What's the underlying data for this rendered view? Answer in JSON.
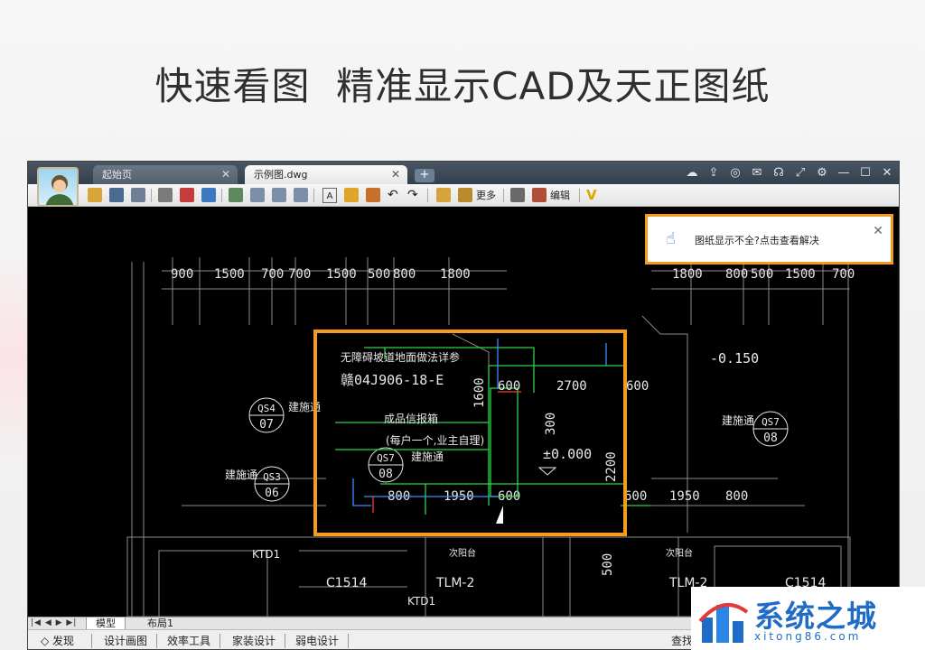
{
  "headline": "快速看图  精准显示CAD及天正图纸",
  "tabs": [
    {
      "label": "起始页",
      "close": "✕"
    },
    {
      "label": "示例图.dwg",
      "close": "✕"
    }
  ],
  "new_tab": "+",
  "window_buttons": {
    "minimize": "—",
    "maximize": "☐",
    "close": "✕"
  },
  "toolbar": {
    "more_label": "更多",
    "edit_label": "编辑",
    "text_icon": "A"
  },
  "notice": {
    "text": "图纸显示不全?点击查看解决",
    "close": "✕"
  },
  "drawing": {
    "top_dims_left": [
      "900",
      "1500",
      "700",
      "700",
      "1500",
      "500",
      "800",
      "1800"
    ],
    "top_dims_right": [
      "1800",
      "800",
      "500",
      "1500",
      "700"
    ],
    "inner_dims": [
      "600",
      "2700",
      "600"
    ],
    "bottom_dims_left": [
      "800",
      "1950",
      "600"
    ],
    "bottom_dims_right": [
      "600",
      "1950",
      "800"
    ],
    "vert_dims": [
      "1600",
      "300",
      "2200",
      "500"
    ],
    "level_minus": "-0.150",
    "level_zero": "±0.000",
    "note_ramp": "无障碍坡道地面做法详参",
    "note_ref": "赣04J906-18-E",
    "note_mailbox": "成品信报箱",
    "note_mailbox_sub": "(每户一个,业主自理)",
    "jst": "建施通",
    "balcony": "次阳台",
    "ktd": "KTD1",
    "tlm": "TLM-2",
    "c1514": "C1514",
    "qs": [
      {
        "top": "QS4",
        "bottom": "07"
      },
      {
        "top": "QS3",
        "bottom": "06"
      },
      {
        "top": "QS7",
        "bottom": "08"
      },
      {
        "top": "QS7",
        "bottom": "08"
      }
    ]
  },
  "layout_tabs": {
    "nav": "|◀ ◀ ▶ ▶|",
    "model": "模型",
    "layout1": "布局1"
  },
  "statusbar": {
    "items": [
      "◇ 发现",
      "设计画图",
      "效率工具",
      "家装设计",
      "弱电设计"
    ],
    "right": "查找"
  },
  "watermark": {
    "name": "系统之城",
    "url": "xitong86.com"
  },
  "colors": {
    "highlight_box": "#f39a1f",
    "cad_green": "#2fd44a",
    "cad_blue": "#3f8cff",
    "cad_white": "#e8e8e8"
  }
}
